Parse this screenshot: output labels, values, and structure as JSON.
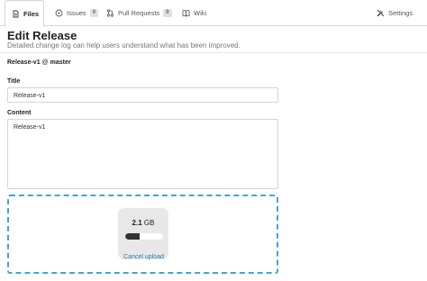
{
  "tabs": [
    {
      "label": "Files",
      "icon": "file-icon",
      "active": true
    },
    {
      "label": "Issues",
      "icon": "issue-icon",
      "count": "0"
    },
    {
      "label": "Pull Requests",
      "icon": "pull-request-icon",
      "count": "0"
    },
    {
      "label": "Wiki",
      "icon": "book-icon"
    }
  ],
  "settings": {
    "label": "Settings",
    "icon": "tools-icon"
  },
  "header": {
    "title": "Edit Release",
    "subtitle": "Detailed change log can help users understand what has been improved."
  },
  "release": {
    "tag": "Release-v1",
    "at": "@",
    "branch": "master"
  },
  "form": {
    "title_label": "Title",
    "title_value": "Release-v1",
    "content_label": "Content",
    "content_value": "Release-v1"
  },
  "upload": {
    "size_value": "2.1",
    "size_unit": "GB",
    "progress": 0.38,
    "cancel_label": "Cancel upload"
  },
  "colors": {
    "accent": "#3ea6d8",
    "link": "#2a7ab0"
  }
}
